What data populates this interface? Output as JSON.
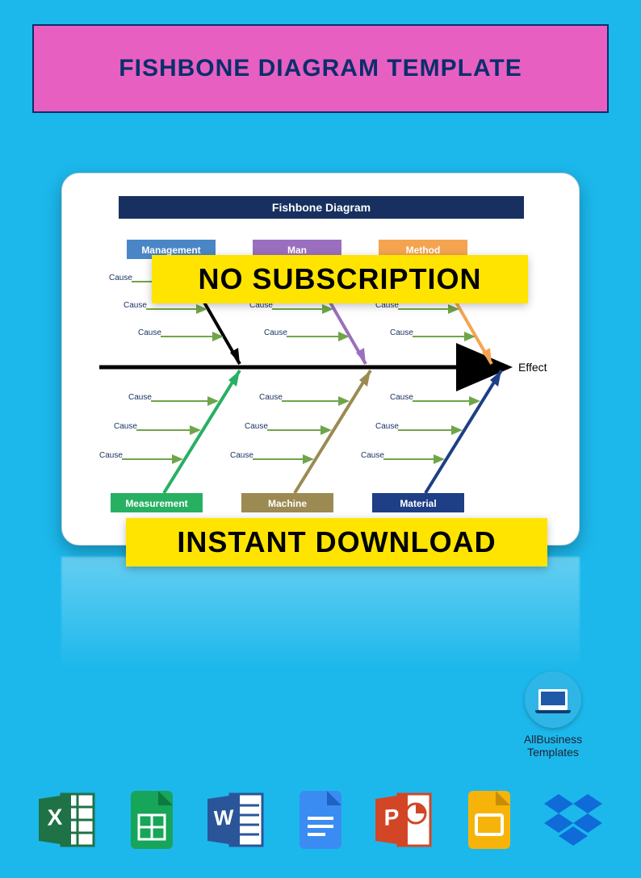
{
  "header": {
    "title": "FISHBONE DIAGRAM TEMPLATE"
  },
  "overlays": {
    "no_sub": "NO SUBSCRIPTION",
    "instant": "INSTANT DOWNLOAD"
  },
  "logo": {
    "line1": "AllBusiness",
    "line2": "Templates"
  },
  "diagram": {
    "title": "Fishbone Diagram",
    "effect_label": "Effect",
    "top_categories": [
      {
        "label": "Management",
        "color": "#4a86c6"
      },
      {
        "label": "Man",
        "color": "#9a6fbf"
      },
      {
        "label": "Method",
        "color": "#f4a451"
      }
    ],
    "bottom_categories": [
      {
        "label": "Measurement",
        "color": "#28b062"
      },
      {
        "label": "Machine",
        "color": "#9b8a52"
      },
      {
        "label": "Material",
        "color": "#1e3f86"
      }
    ],
    "cause_label": "Cause"
  },
  "icons": [
    "excel",
    "sheets",
    "word",
    "docs",
    "powerpoint",
    "slides",
    "dropbox"
  ]
}
